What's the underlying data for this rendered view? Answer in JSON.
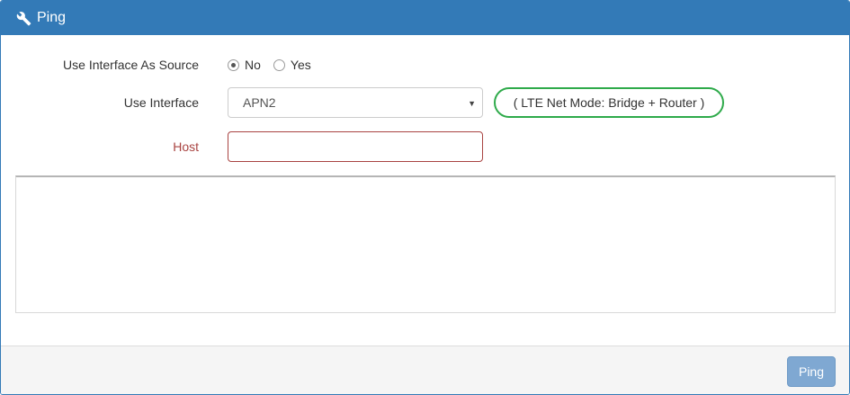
{
  "panel": {
    "title": "Ping",
    "icon": "wrench-icon",
    "header_color": "#337ab7"
  },
  "form": {
    "use_interface_as_source": {
      "label": "Use Interface As Source",
      "options": [
        {
          "label": "No",
          "checked": true
        },
        {
          "label": "Yes",
          "checked": false
        }
      ]
    },
    "use_interface": {
      "label": "Use Interface",
      "selected": "APN2",
      "note": "( LTE Net Mode: Bridge + Router )",
      "note_color": "#2eaa4a"
    },
    "host": {
      "label": "Host",
      "value": "",
      "placeholder": "",
      "error_color": "#a94442"
    }
  },
  "output": {
    "value": ""
  },
  "footer": {
    "ping_label": "Ping",
    "button_color": "#7fa8d2"
  }
}
